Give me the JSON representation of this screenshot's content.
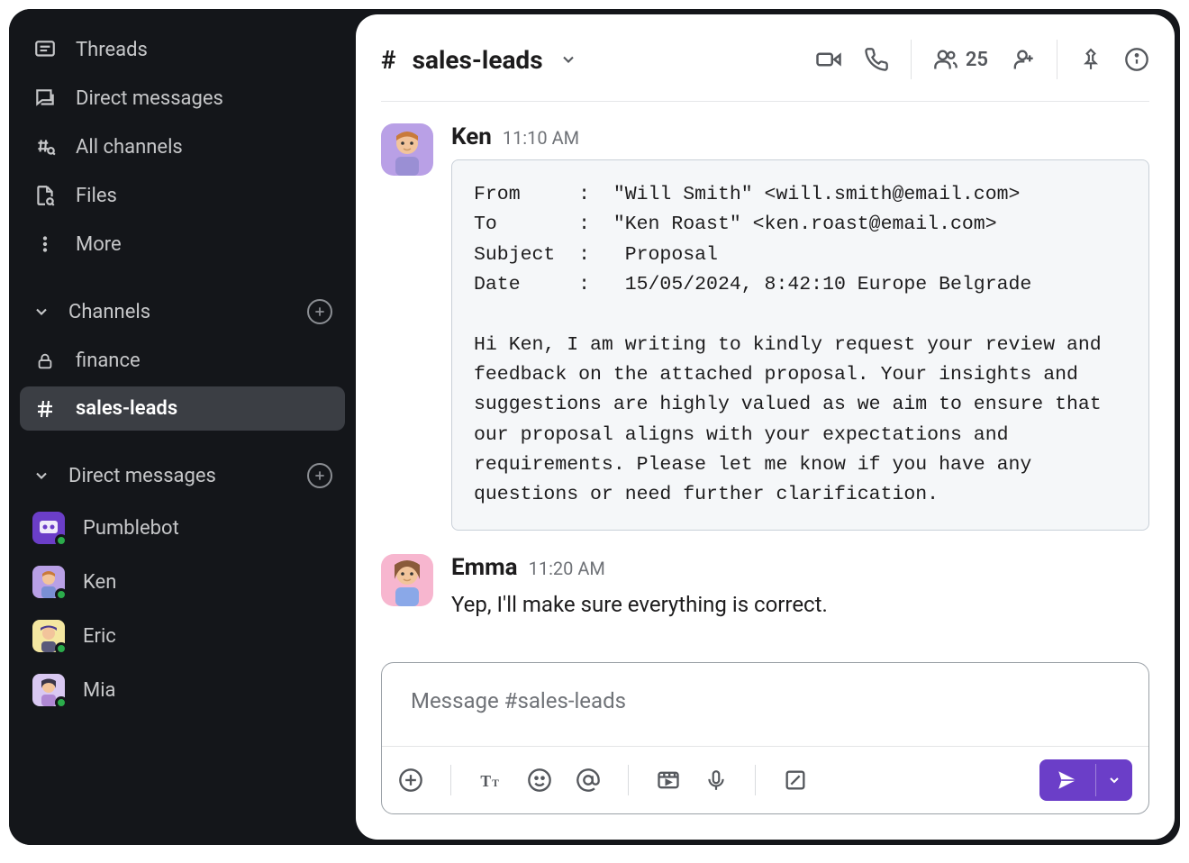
{
  "sidebar": {
    "nav": [
      {
        "label": "Threads"
      },
      {
        "label": "Direct messages"
      },
      {
        "label": "All channels"
      },
      {
        "label": "Files"
      },
      {
        "label": "More"
      }
    ],
    "channels_header": "Channels",
    "channels": [
      {
        "label": "finance",
        "locked": true,
        "active": false
      },
      {
        "label": "sales-leads",
        "locked": false,
        "active": true
      }
    ],
    "dm_header": "Direct messages",
    "dms": [
      {
        "label": "Pumblebot"
      },
      {
        "label": "Ken"
      },
      {
        "label": "Eric"
      },
      {
        "label": "Mia"
      }
    ]
  },
  "header": {
    "channel_name": "sales-leads",
    "member_count": "25"
  },
  "messages": [
    {
      "author": "Ken",
      "time": "11:10 AM",
      "code": "From     :  \"Will Smith\" <will.smith@email.com>\nTo       :  \"Ken Roast\" <ken.roast@email.com>\nSubject  :   Proposal\nDate     :   15/05/2024, 8:42:10 Europe Belgrade\n\nHi Ken, I am writing to kindly request your review and feedback on the attached proposal. Your insights and suggestions are highly valued as we aim to ensure that our proposal aligns with your expectations and requirements. Please let me know if you have any questions or need further clarification."
    },
    {
      "author": "Emma",
      "time": "11:20 AM",
      "text": "Yep, I'll make sure everything is correct."
    }
  ],
  "composer": {
    "placeholder": "Message #sales-leads"
  },
  "avatar_colors": {
    "ken": "#b9a0e6",
    "emma": "#f7b6cf",
    "pumblebot": "#6b3ec8",
    "eric": "#f4e7a1",
    "mia": "#d9c8f2"
  }
}
